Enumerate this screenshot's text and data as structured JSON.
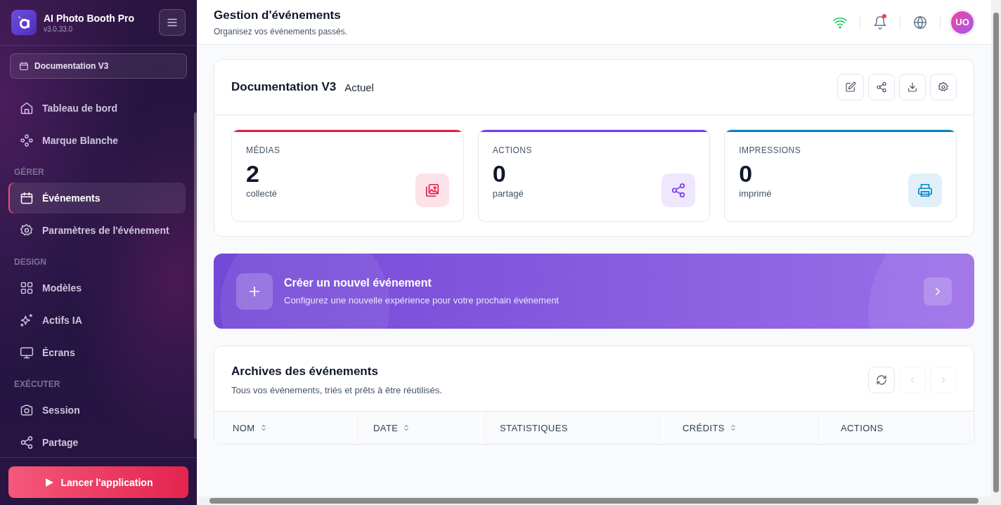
{
  "app": {
    "name": "AI Photo Booth Pro",
    "version": "v3.0.33.0"
  },
  "event_selector": {
    "label": "Documentation V3"
  },
  "sidebar": {
    "items": [
      {
        "kind": "item",
        "label": "Tableau de bord",
        "selected": false
      },
      {
        "kind": "item",
        "label": "Marque Blanche",
        "selected": false
      },
      {
        "kind": "section",
        "label": "GÉRER"
      },
      {
        "kind": "item",
        "label": "Événements",
        "selected": true
      },
      {
        "kind": "item",
        "label": "Paramètres de l'événement",
        "selected": false
      },
      {
        "kind": "section",
        "label": "DESIGN"
      },
      {
        "kind": "item",
        "label": "Modèles",
        "selected": false
      },
      {
        "kind": "item",
        "label": "Actifs IA",
        "selected": false
      },
      {
        "kind": "item",
        "label": "Écrans",
        "selected": false
      },
      {
        "kind": "section",
        "label": "EXÉCUTER"
      },
      {
        "kind": "item",
        "label": "Session",
        "selected": false
      },
      {
        "kind": "item",
        "label": "Partage",
        "selected": false
      }
    ]
  },
  "launch_button": {
    "label": "Lancer l'application"
  },
  "header": {
    "title": "Gestion d'événements",
    "subtitle": "Organisez vos événements passés.",
    "notifications_unread": true,
    "avatar": "UO"
  },
  "current_event": {
    "name": "Documentation V3",
    "status": "Actuel",
    "stats": [
      {
        "label": "MÉDIAS",
        "value": "2",
        "caption": "collecté",
        "color": "#e11d48"
      },
      {
        "label": "ACTIONS",
        "value": "0",
        "caption": "partagé",
        "color": "#7c3aed"
      },
      {
        "label": "IMPRESSIONS",
        "value": "0",
        "caption": "imprimé",
        "color": "#0284c7"
      }
    ]
  },
  "create_banner": {
    "title": "Créer un nouvel événement",
    "subtitle": "Configurez une nouvelle expérience pour votre prochain événement"
  },
  "archive": {
    "title": "Archives des événements",
    "subtitle": "Tous vos événements, triés et prêts à être réutilisés.",
    "columns": [
      {
        "label": "NOM",
        "sortable": true
      },
      {
        "label": "DATE",
        "sortable": true
      },
      {
        "label": "STATISTIQUES",
        "sortable": false
      },
      {
        "label": "CRÉDITS",
        "sortable": true
      },
      {
        "label": "ACTIONS",
        "sortable": false
      }
    ]
  }
}
